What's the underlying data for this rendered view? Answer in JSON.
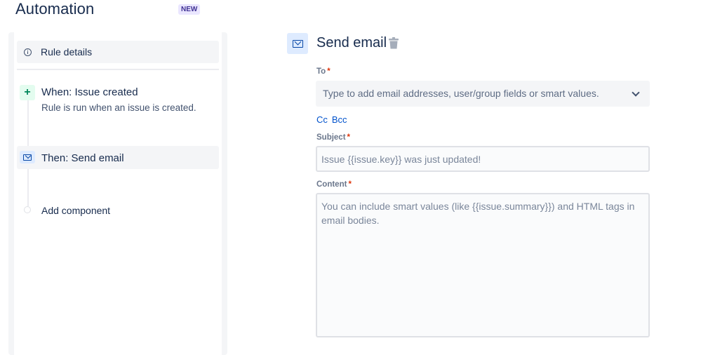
{
  "page": {
    "title": "Automation",
    "badge": "NEW"
  },
  "rule": {
    "details_label": "Rule details",
    "trigger": {
      "title": "When: Issue created",
      "description": "Rule is run when an issue is created."
    },
    "action": {
      "title": "Then: Send email"
    },
    "add_component_label": "Add component"
  },
  "editor": {
    "title": "Send email",
    "to": {
      "label": "To",
      "placeholder": "Type to add email addresses, user/group fields or smart values."
    },
    "cc_label": "Cc",
    "bcc_label": "Bcc",
    "subject": {
      "label": "Subject",
      "placeholder": "Issue {{issue.key}} was just updated!"
    },
    "content": {
      "label": "Content",
      "placeholder": "You can include smart values (like {{issue.summary}}) and HTML tags in email bodies."
    },
    "required_marker": "*"
  },
  "colors": {
    "accent": "#0052cc",
    "required": "#de350b",
    "trigger_green": "#00875a"
  }
}
